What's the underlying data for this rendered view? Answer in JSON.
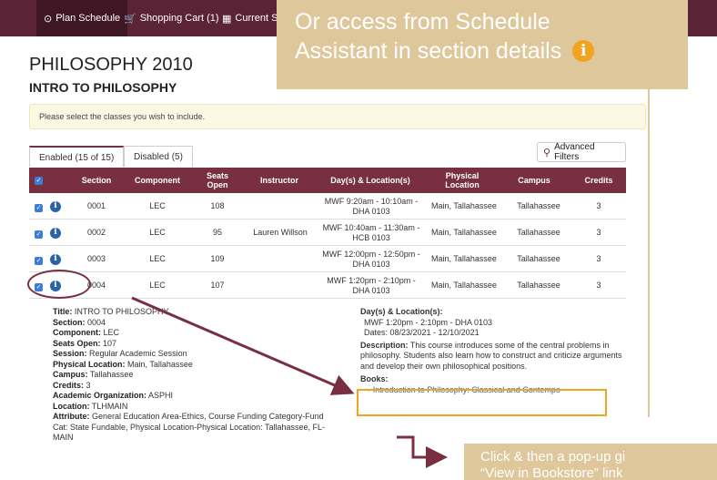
{
  "nav": {
    "plan": "Plan Schedule",
    "cart": "Shopping Cart (1)",
    "current": "Current Sc"
  },
  "course": {
    "code": "PHILOSOPHY 2010",
    "title": "INTRO TO PHILOSOPHY"
  },
  "callout_top": {
    "line1": "Or access from Schedule",
    "line2": "Assistant in section details"
  },
  "notice": "Please select the classes you wish to include.",
  "tabs": {
    "enabled": "Enabled (15 of 15)",
    "disabled": "Disabled (5)"
  },
  "advanced_filters": "Advanced Filters",
  "table": {
    "headers": [
      "Section",
      "Component",
      "Seats Open",
      "Instructor",
      "Day(s) & Location(s)",
      "Physical Location",
      "Campus",
      "Credits"
    ],
    "rows": [
      {
        "section": "0001",
        "component": "LEC",
        "seats": "108",
        "instructor": "",
        "days": "MWF 9:20am - 10:10am - DHA 0103",
        "location": "Main, Tallahassee",
        "campus": "Tallahassee",
        "credits": "3"
      },
      {
        "section": "0002",
        "component": "LEC",
        "seats": "95",
        "instructor": "Lauren Willson",
        "days": "MWF 10:40am - 11:30am - HCB 0103",
        "location": "Main, Tallahassee",
        "campus": "Tallahassee",
        "credits": "3"
      },
      {
        "section": "0003",
        "component": "LEC",
        "seats": "109",
        "instructor": "",
        "days": "MWF 12:00pm - 12:50pm - DHA 0103",
        "location": "Main, Tallahassee",
        "campus": "Tallahassee",
        "credits": "3"
      },
      {
        "section": "0004",
        "component": "LEC",
        "seats": "107",
        "instructor": "",
        "days": "MWF 1:20pm - 2:10pm - DHA 0103",
        "location": "Main, Tallahassee",
        "campus": "Tallahassee",
        "credits": "3"
      }
    ]
  },
  "details": {
    "title_label": "Title:",
    "title": "INTRO TO PHILOSOPHY",
    "section_label": "Section:",
    "section": "0004",
    "component_label": "Component:",
    "component": "LEC",
    "seats_label": "Seats Open:",
    "seats": "107",
    "session_label": "Session:",
    "session": "Regular Academic Session",
    "physloc_label": "Physical Location:",
    "physloc": "Main, Tallahassee",
    "campus_label": "Campus:",
    "campus": "Tallahassee",
    "credits_label": "Credits:",
    "credits": "3",
    "acadorg_label": "Academic Organization:",
    "acadorg": "ASPHI",
    "location_label": "Location:",
    "location": "TLHMAIN",
    "attribute_label": "Attribute:",
    "attribute": "General Education Area-Ethics, Course Funding Category-Fund Cat: State Fundable, Physical Location-Physical Location: Tallahassee, FL-MAIN",
    "days_label": "Day(s) & Location(s):",
    "days": "MWF 1:20pm - 2:10pm - DHA 0103",
    "dates": "Dates: 08/23/2021 - 12/10/2021",
    "desc_label": "Description:",
    "desc": "This course introduces some of the central problems in philosophy. Students also learn how to construct and criticize arguments and develop their own philosophical positions.",
    "books_label": "Books:",
    "book": "Introduction to Philosophy: Classical and Contempo"
  },
  "callout_bottom": {
    "line1": "Click & then a pop-up gi",
    "line2": "“View in Bookstore” link"
  },
  "colors": {
    "garnet": "#782f40",
    "topbar": "#5b2436",
    "gold_callout": "#dec79a",
    "orange": "#f0a422",
    "blue": "#2a63a8"
  }
}
